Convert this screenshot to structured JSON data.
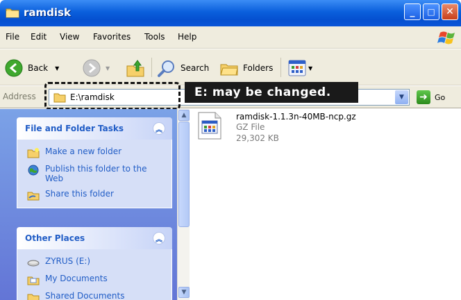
{
  "window": {
    "title": "ramdisk"
  },
  "menu": [
    "File",
    "Edit",
    "View",
    "Favorites",
    "Tools",
    "Help"
  ],
  "toolbar": {
    "back": "Back",
    "search": "Search",
    "folders": "Folders"
  },
  "address": {
    "label": "Address",
    "value": "E:\\ramdisk",
    "go": "Go"
  },
  "annotation": {
    "callout": "E: may be changed."
  },
  "tasks": {
    "title": "File and Folder Tasks",
    "items": [
      "Make a new folder",
      "Publish this folder to the Web",
      "Share this folder"
    ]
  },
  "other_places": {
    "title": "Other Places",
    "items": [
      "ZYRUS (E:)",
      "My Documents",
      "Shared Documents"
    ]
  },
  "file": {
    "name": "ramdisk-1.1.3n-40MB-ncp.gz",
    "type": "GZ File",
    "size": "29,302 KB"
  },
  "colors": {
    "titlebar": "#0a5fdc",
    "task_link": "#215dc6",
    "pane": "#7ba2e7"
  }
}
